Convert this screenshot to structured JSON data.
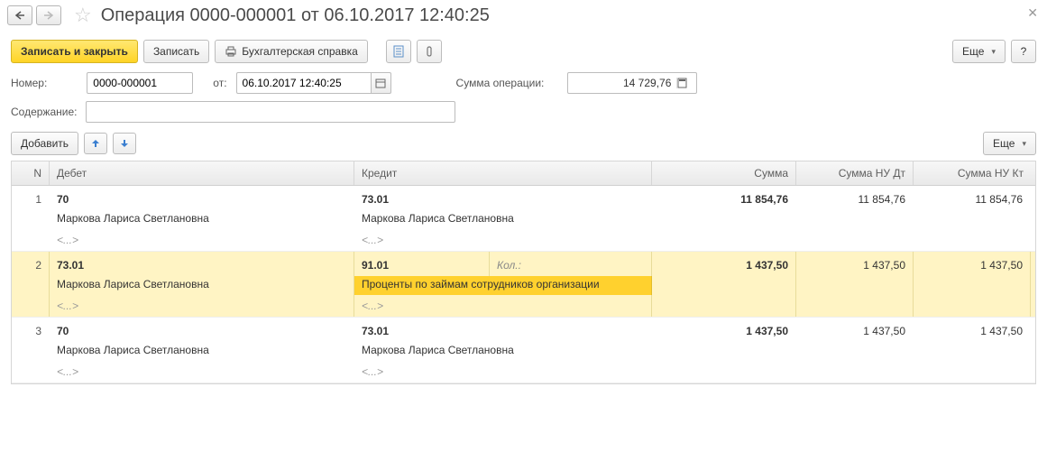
{
  "header": {
    "title": "Операция 0000-000001 от 06.10.2017 12:40:25"
  },
  "toolbar": {
    "save_close": "Записать и закрыть",
    "save": "Записать",
    "accounting_note": "Бухгалтерская справка",
    "more": "Еще",
    "help": "?"
  },
  "form": {
    "number_label": "Номер:",
    "number": "0000-000001",
    "from_label": "от:",
    "date": "06.10.2017 12:40:25",
    "sum_label": "Сумма операции:",
    "sum": "14 729,76",
    "content_label": "Содержание:",
    "content": ""
  },
  "grid_toolbar": {
    "add": "Добавить",
    "more": "Еще"
  },
  "columns": {
    "n": "N",
    "debit": "Дебет",
    "credit": "Кредит",
    "sum": "Сумма",
    "nu_dt": "Сумма НУ Дт",
    "nu_kt": "Сумма НУ Кт"
  },
  "placeholders": {
    "ellipsis": "<...>",
    "kol": "Кол.:"
  },
  "rows": [
    {
      "n": "1",
      "debit_acct": "70",
      "debit_sub": "Маркова Лариса Светлановна",
      "credit_acct": "73.01",
      "credit_sub": "Маркова Лариса Светлановна",
      "sum": "11 854,76",
      "nu_dt": "11 854,76",
      "nu_kt": "11 854,76",
      "selected": false
    },
    {
      "n": "2",
      "debit_acct": "73.01",
      "debit_sub": "Маркова Лариса Светлановна",
      "credit_acct": "91.01",
      "credit_sub": "Проценты по займам сотрудников организации",
      "sum": "1 437,50",
      "nu_dt": "1 437,50",
      "nu_kt": "1 437,50",
      "selected": true
    },
    {
      "n": "3",
      "debit_acct": "70",
      "debit_sub": "Маркова Лариса Светлановна",
      "credit_acct": "73.01",
      "credit_sub": "Маркова Лариса Светлановна",
      "sum": "1 437,50",
      "nu_dt": "1 437,50",
      "nu_kt": "1 437,50",
      "selected": false
    }
  ]
}
